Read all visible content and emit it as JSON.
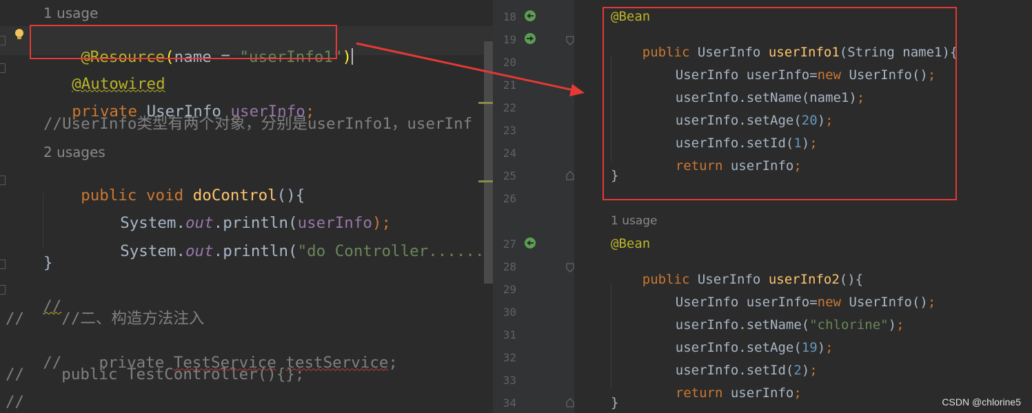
{
  "left_editor": {
    "usage_hint_1": "1 usage",
    "resource_annotation": "@Resource",
    "resource_param": "name",
    "resource_eq": " = ",
    "resource_value": "\"userInfo1\"",
    "autowired_annotation": "@Autowired",
    "field_modifier": "private",
    "field_type": "UserInfo",
    "field_name": "userInfo",
    "comment_line": "//UserInfo类型有两个对象，分别是userInfo1，userInf",
    "usage_hint_2": "2 usages",
    "method_modifier": "public",
    "method_return": "void",
    "method_name": "doControl",
    "println1_prefix": "System.",
    "println1_out": "out",
    "println1_call": ".println(",
    "println1_arg": "userInfo",
    "println1_end": ");",
    "println2_prefix": "System.",
    "println2_out": "out",
    "println2_call": ".println(",
    "println2_arg": "\"do Controller.........'",
    "close_brace": "}",
    "comment_empty_1": "//",
    "comment_empty_1_extra": "//",
    "comment_constructor": "//    //二、构造方法注入",
    "comment_private_prefix": "//    private ",
    "comment_private_type": "TestService",
    "comment_private_name": "testService",
    "comment_private_end": ";",
    "comment_public_ctor": "//    public TestController(){};",
    "comment_empty_2": "//"
  },
  "right_editor": {
    "line_numbers": [
      "18",
      "19",
      "20",
      "21",
      "22",
      "23",
      "24",
      "25",
      "26",
      "27",
      "28",
      "29",
      "30",
      "31",
      "32",
      "33",
      "34"
    ],
    "bean1": {
      "annotation": "@Bean",
      "modifier": "public",
      "return_type": "UserInfo",
      "method_name": "userInfo1",
      "params": "(String name1){",
      "new_line_decl": "UserInfo userInfo=",
      "new_kw": "new",
      "new_ctor": " UserInfo()",
      "set_name": "userInfo.setName(name1)",
      "set_age_prefix": "userInfo.setAge(",
      "set_age_value": "20",
      "set_id_prefix": "userInfo.setId(",
      "set_id_value": "1",
      "return_kw": "return",
      "return_value": " userInfo",
      "close": "}"
    },
    "usage_hint": "1 usage",
    "bean2": {
      "annotation": "@Bean",
      "modifier": "public",
      "return_type": "UserInfo",
      "method_name": "userInfo2",
      "params": "(){",
      "new_line_decl": "UserInfo userInfo=",
      "new_kw": "new",
      "new_ctor": " UserInfo()",
      "set_name_prefix": "userInfo.setName(",
      "set_name_value": "\"chlorine\"",
      "set_age_prefix": "userInfo.setAge(",
      "set_age_value": "19",
      "set_id_prefix": "userInfo.setId(",
      "set_id_value": "2",
      "return_kw": "return",
      "return_value": " userInfo",
      "close": "}"
    }
  },
  "punct": {
    "semicolon": ";",
    "close_paren": ")",
    "open_paren": "(",
    "paren_brace": "(){"
  },
  "watermark": "CSDN @chlorine5",
  "colors": {
    "background": "#2b2b2b",
    "keyword": "#cc7832",
    "annotation": "#bbb529",
    "string": "#6a8759",
    "number": "#6897bb",
    "field": "#9876aa",
    "method_decl": "#ffc66d",
    "comment": "#808080",
    "highlight_box": "#e53935"
  }
}
